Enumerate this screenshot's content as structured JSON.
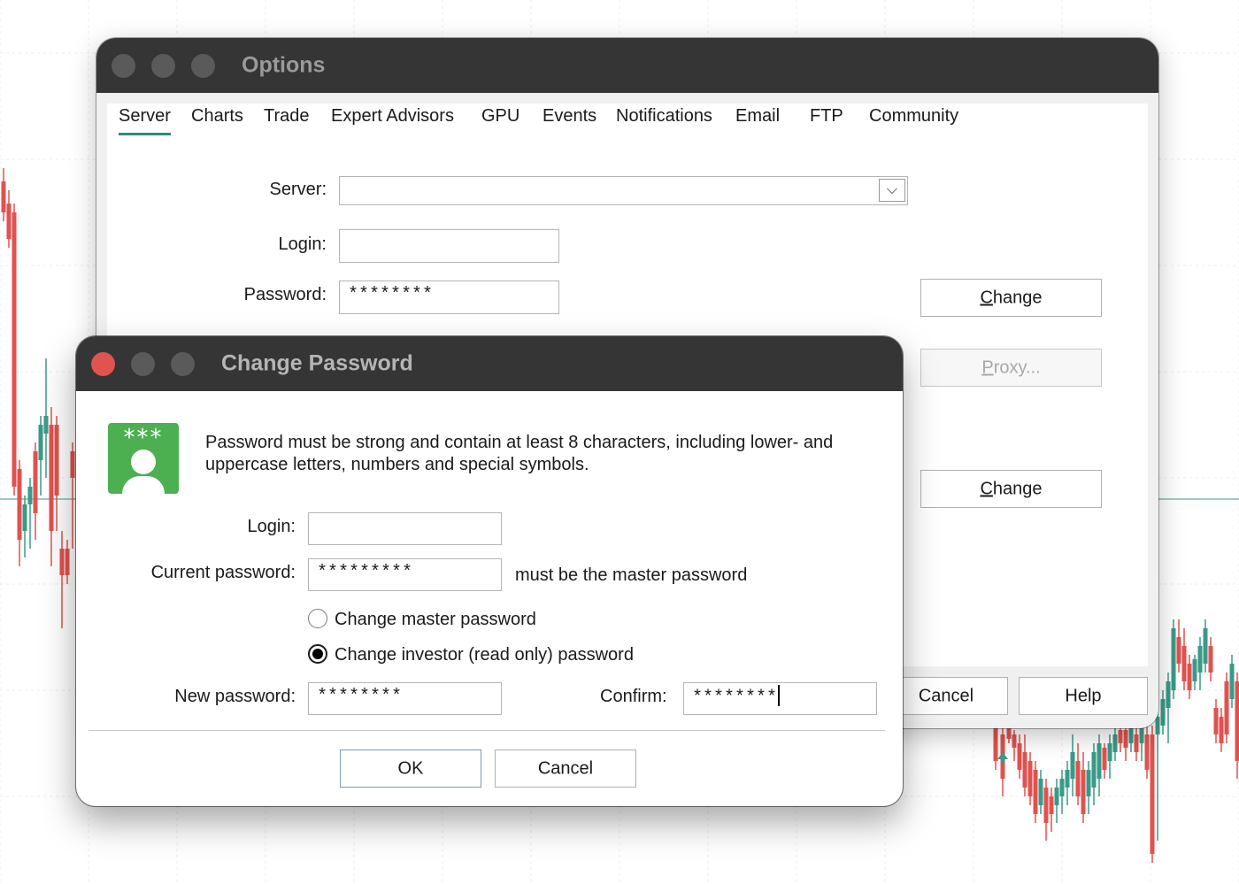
{
  "options_window": {
    "title": "Options",
    "tabs": [
      {
        "label": "Server",
        "active": true
      },
      {
        "label": "Charts"
      },
      {
        "label": "Trade"
      },
      {
        "label": "Expert Advisors"
      },
      {
        "label": "GPU"
      },
      {
        "label": "Events"
      },
      {
        "label": "Notifications"
      },
      {
        "label": "Email"
      },
      {
        "label": "FTP"
      },
      {
        "label": "Community"
      }
    ],
    "server_label": "Server:",
    "server_value": "",
    "login_label": "Login:",
    "login_value": "",
    "password_label": "Password:",
    "password_value": "********",
    "change_button_1": "Change",
    "proxy_button": "Proxy...",
    "change_button_2": "Change",
    "cancel_button": "Cancel",
    "help_button": "Help"
  },
  "password_dialog": {
    "title": "Change Password",
    "icon_stars": "***",
    "message": "Password must be strong and contain at least 8 characters, including lower- and uppercase letters, numbers and special symbols.",
    "login_label": "Login:",
    "login_value": "",
    "current_password_label": "Current password:",
    "current_password_value": "*********",
    "current_password_hint": "must be the master password",
    "radio_master": "Change master password",
    "radio_investor": "Change investor (read only) password",
    "selected_radio": "investor",
    "new_password_label": "New password:",
    "new_password_value": "********",
    "confirm_label": "Confirm:",
    "confirm_value": "********",
    "ok_button": "OK",
    "cancel_button": "Cancel"
  },
  "colors": {
    "titlebar": "#353535",
    "accent_tab": "#2e8a7c",
    "close_red": "#e0534f",
    "icon_green": "#4caf50",
    "candle_up": "#3a9a88",
    "candle_down": "#e0524e"
  }
}
